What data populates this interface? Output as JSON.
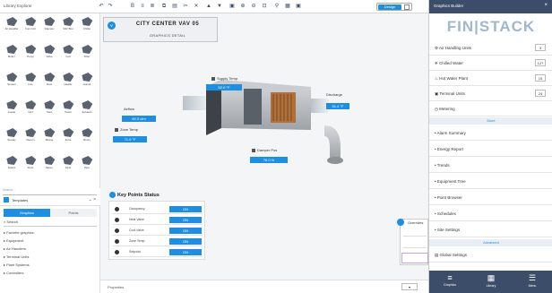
{
  "topbar": {
    "title": "Library Explorer",
    "mode_label": "Design"
  },
  "library": {
    "thumbs": [
      "Air Handler",
      "Fan Coil",
      "Damper",
      "VAV Box",
      "Chiller",
      "Boiler",
      "Pump",
      "Valve",
      "Coil",
      "Filter",
      "Sensor",
      "Fan",
      "Duct",
      "Heater",
      "Humid",
      "Cooler",
      "Unit",
      "Vent",
      "Tower",
      "Exhaust",
      "Supply",
      "Return",
      "Mixing",
      "Zone",
      "Room",
      "Space",
      "Floor",
      "Meter",
      "Tank",
      "Pipe"
    ],
    "search_placeholder": "Search..."
  },
  "leftpanel": {
    "header": "Templates",
    "tabs": [
      "Graphics",
      "Points"
    ],
    "search": "Search",
    "rows": [
      "Favorite graphics",
      "Equipment",
      "Air Handlers",
      "Terminal Units",
      "Plant Systems",
      "Controllers"
    ]
  },
  "titlebox": {
    "title": "CITY CENTER VAV 05",
    "subtitle": "GRAPHICS DETAIL"
  },
  "labels": {
    "supply_temp": {
      "label": "Supply Temp",
      "value": "52.0 °F"
    },
    "discharge": {
      "label": "Discharge",
      "value": "51.4 °F"
    },
    "airflow": {
      "label": "Airflow",
      "value": "60.0 cfm"
    },
    "zone_temp": {
      "label": "Zone Temp",
      "value": "71.0 °F"
    },
    "damper": {
      "label": "Damper Pos",
      "value": "76.0 %"
    },
    "setpoint": {
      "label": "Setpoint",
      "value": "70.0 %"
    }
  },
  "point_table": {
    "title": "Key Points Status",
    "rows": [
      {
        "name": "Occupancy",
        "value": "ON"
      },
      {
        "name": "Heat Valve",
        "value": "ON"
      },
      {
        "name": "Cool Valve",
        "value": "ON"
      },
      {
        "name": "Zone Temp",
        "value": "ON"
      },
      {
        "name": "Setpoint",
        "value": "ON"
      }
    ]
  },
  "bottombar": {
    "text": "Properties"
  },
  "right": {
    "top_label": "Graphics Builder",
    "brand": "FIN|STACK",
    "rows": [
      {
        "label": "Air Handling Units",
        "badge": "3"
      },
      {
        "label": "Chilled Water",
        "badge": "127"
      },
      {
        "label": "Hot Water Plant",
        "badge": "15"
      },
      {
        "label": "Terminal Units",
        "badge": "24"
      },
      {
        "label": "Metering",
        "badge": ""
      }
    ],
    "sep1": "More",
    "rows2": [
      "Alarm Summary",
      "Energy Report",
      "Trends",
      "Equipment Tree",
      "Point Browser"
    ],
    "rows3": [
      "Schedules",
      "Site Settings"
    ],
    "sep2": "Advanced",
    "last_row": "Global Settings",
    "footer": [
      {
        "icon": "≡",
        "label": "Graphics"
      },
      {
        "icon": "▦",
        "label": "Library"
      },
      {
        "icon": "☰",
        "label": "Menu"
      }
    ]
  },
  "floating": {
    "title": "Overrides"
  },
  "colors": {
    "accent": "#1e8fe0",
    "navy": "#3c4d6a"
  }
}
